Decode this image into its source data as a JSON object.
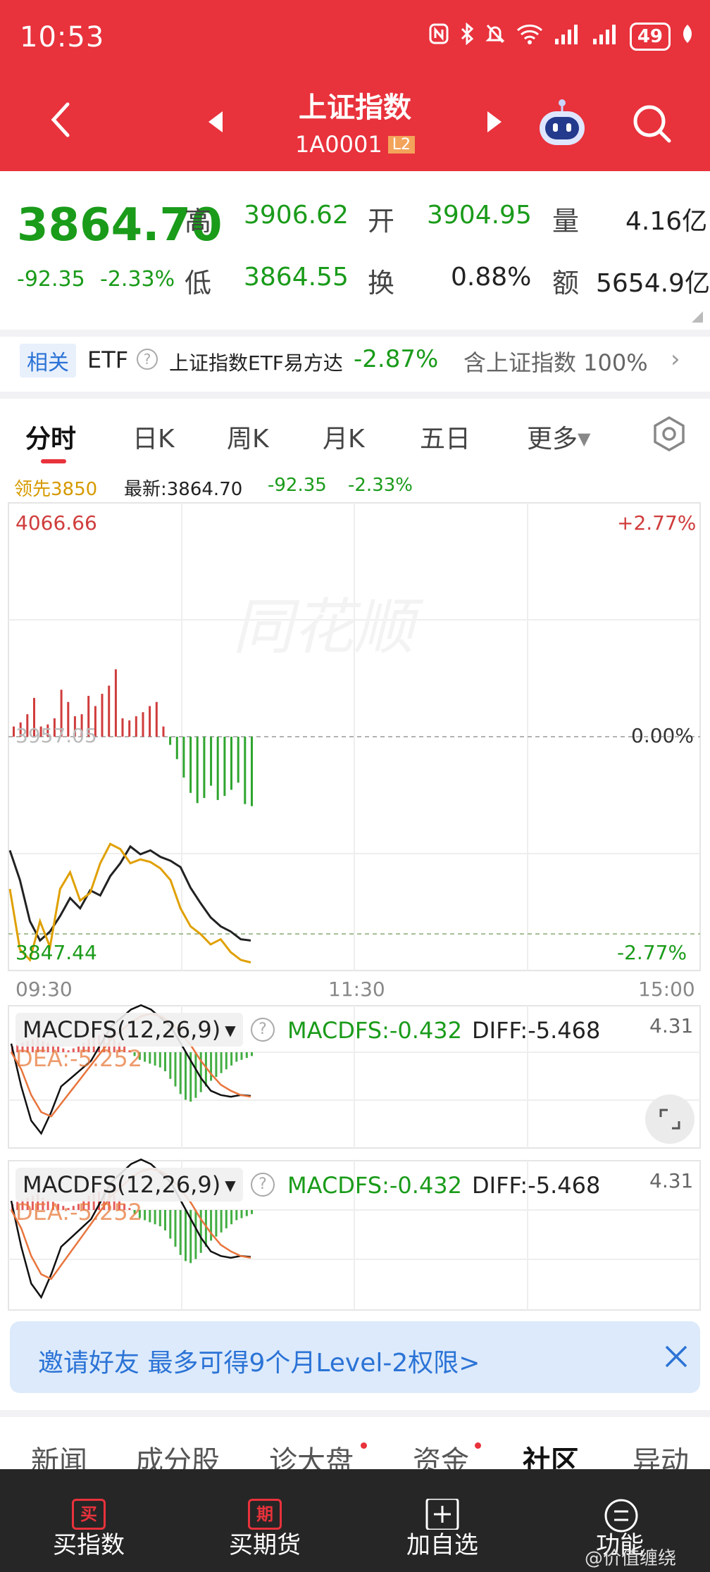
{
  "status_bar": {
    "time": "10:53",
    "battery": "49"
  },
  "header": {
    "title": "上证指数",
    "code": "1A0001",
    "badge": "L2"
  },
  "quote": {
    "price": "3864.70",
    "change": "-92.35",
    "change_pct": "-2.33%",
    "high_label": "高",
    "high": "3906.62",
    "open_label": "开",
    "open": "3904.95",
    "volume_label": "量",
    "volume": "4.16亿",
    "low_label": "低",
    "low": "3864.55",
    "turnover_label": "换",
    "turnover": "0.88%",
    "amount_label": "额",
    "amount": "5654.9亿"
  },
  "related": {
    "tag": "相关",
    "type": "ETF",
    "name": "上证指数ETF易方达",
    "pct": "-2.87%",
    "contains": "含上证指数 100%"
  },
  "chart_tabs": [
    "分时",
    "日K",
    "周K",
    "月K",
    "五日",
    "更多"
  ],
  "legend": {
    "lead": "领先3850",
    "latest": "最新:3864.70",
    "change": "-92.35",
    "change_pct": "-2.33%"
  },
  "chart_data": {
    "type": "line",
    "y_top_label": "4066.66",
    "y_bottom_label": "3847.44",
    "pct_top": "+2.77%",
    "pct_mid": "0.00%",
    "pct_bottom": "-2.77%",
    "mid_label": "3957.05",
    "x_labels": [
      "09:30",
      "11:30",
      "15:00"
    ],
    "series": [
      {
        "values": [
          3935,
          3912,
          3880,
          3865,
          3872,
          3884,
          3898,
          3890,
          3904,
          3900,
          3915,
          3925,
          3938,
          3932,
          3935,
          3930,
          3927,
          3922,
          3906,
          3894,
          3883,
          3876,
          3872,
          3866,
          3865
        ]
      },
      {
        "values": [
          3905,
          3858,
          3850,
          3880,
          3860,
          3905,
          3918,
          3896,
          3902,
          3925,
          3940,
          3936,
          3925,
          3928,
          3926,
          3921,
          3912,
          3890,
          3876,
          3870,
          3862,
          3866,
          3856,
          3850,
          3848
        ]
      }
    ],
    "lead_bars": [
      10,
      14,
      22,
      38,
      10,
      12,
      18,
      46,
      34,
      20,
      22,
      40,
      30,
      42,
      50,
      66,
      18,
      16,
      20,
      24,
      30,
      34,
      10,
      -8,
      -22,
      -40,
      -55,
      -65,
      -60,
      -48,
      -62,
      -58,
      -52,
      -45,
      -66,
      -68
    ]
  },
  "macd": {
    "label": "MACDFS(12,26,9)",
    "macdfs": "MACDFS:-0.432",
    "diff": "DIFF:-5.468",
    "dea": "DEA:-5.252",
    "max": "4.31"
  },
  "invite": {
    "text": "邀请好友 最多可得9个月Level-2权限>"
  },
  "info_tabs": [
    "新闻",
    "成分股",
    "诊大盘",
    "资金",
    "社区",
    "异动"
  ],
  "bottom_nav": [
    {
      "icon": "买",
      "label": "买指数"
    },
    {
      "icon": "期",
      "label": "买期货"
    },
    {
      "label": "加自选"
    },
    {
      "label": "功能"
    }
  ],
  "watermark": "@价值缠绕",
  "colors": {
    "brand_red": "#e8323c",
    "down_green": "#1a9b1a",
    "up_red": "#d03c3c",
    "avg_yellow": "#e0a000",
    "link_blue": "#2b73d6"
  }
}
